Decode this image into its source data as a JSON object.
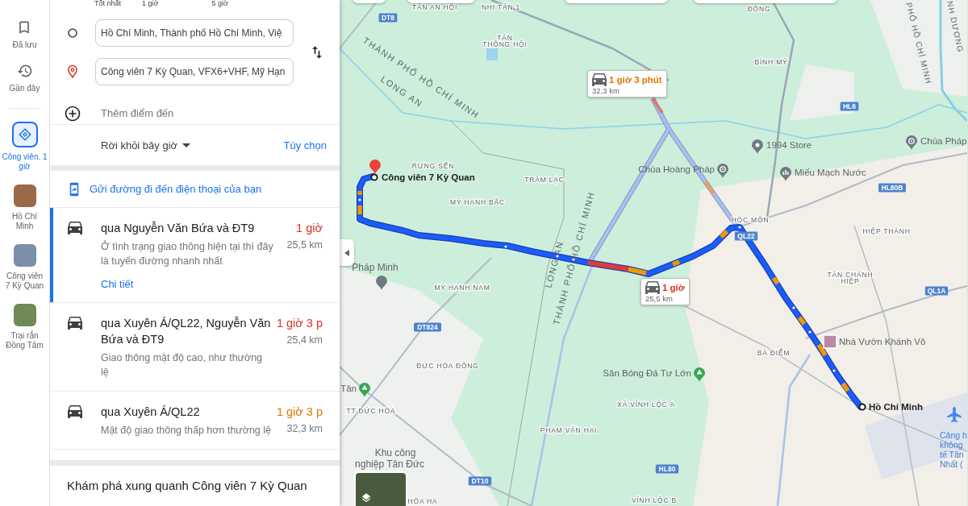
{
  "rail": {
    "items": [
      {
        "kind": "saved",
        "label": "Đã lưu",
        "selected": false
      },
      {
        "kind": "recent",
        "label": "Gần đây",
        "selected": false
      },
      {
        "kind": "directions",
        "label": "Công viên. 1 giờ",
        "selected": true
      },
      {
        "kind": "place",
        "label": "Hồ Chí Minh",
        "selected": false
      },
      {
        "kind": "place",
        "label": "Công viên 7 Kỳ Quan",
        "selected": false
      },
      {
        "kind": "place",
        "label": "Trại rắn Đồng Tâm",
        "selected": false
      }
    ]
  },
  "modes": [
    {
      "label": "Tốt nhất"
    },
    {
      "label": "1 giờ"
    },
    {
      "label": "5 giờ"
    }
  ],
  "directions": {
    "origin": "Hồ Chí Minh, Thành phố Hồ Chí Minh, Việ",
    "destination": "Công viên 7 Kỳ Quan, VFX6+VHF, Mỹ Hạn",
    "add_stop": "Thêm điểm đến",
    "depart": "Rời khỏi bây giờ",
    "options": "Tùy chọn",
    "send_to_phone": "Gửi đường đi đến điện thoại của bạn"
  },
  "routes": [
    {
      "title": "qua Nguyễn Văn Bứa và ĐT9",
      "time": "1 giờ",
      "color": "#d93025",
      "distance": "25,5 km",
      "description": "Ở tình trạng giao thông hiện tại thì đây là tuyến đường nhanh nhất",
      "details": "Chi tiết",
      "selected": true
    },
    {
      "title": "qua Xuyên Á/QL22, Nguyễn Văn Bứa và ĐT9",
      "time": "1 giờ 3 p",
      "color": "#d93025",
      "distance": "25,4 km",
      "description": "Giao thông mật độ cao, như thường lệ",
      "selected": false
    },
    {
      "title": "qua Xuyên Á/QL22",
      "time": "1 giờ 3 p",
      "color": "#e37400",
      "distance": "32,3 km",
      "description": "Mật độ giao thông thấp hơn thường lệ",
      "selected": false
    }
  ],
  "explore": "Khám phá xung quanh Công viên 7 Kỳ Quan",
  "map": {
    "labels": [
      {
        "text": "TÂN AN HỘI",
        "kind": "area"
      },
      {
        "text": "NHỊ TÂN 1",
        "kind": "area"
      },
      {
        "text": "DT8",
        "kind": "shield"
      },
      {
        "text": "ĐÔNG",
        "kind": "area"
      },
      {
        "text": "PHỐ HỒ CHÍ MINH",
        "kind": "region"
      },
      {
        "text": "NH DƯƠNG",
        "kind": "region"
      },
      {
        "text": "TÂN",
        "kind": "area"
      },
      {
        "text": "THÔNG HỘI",
        "kind": "area"
      },
      {
        "text": "THÀNH PHỐ HỒ CHÍ MINH",
        "kind": "region"
      },
      {
        "text": "BÌNH MỸ",
        "kind": "area"
      },
      {
        "text": "LONG AN",
        "kind": "region"
      },
      {
        "text": "HL6",
        "kind": "shield"
      },
      {
        "text": "1994 Store",
        "kind": "pin"
      },
      {
        "text": "Chùa Pháp",
        "kind": "temple"
      },
      {
        "text": "RỪNG SẾN",
        "kind": "area"
      },
      {
        "text": "Công viên 7 Kỳ Quan",
        "kind": "destination"
      },
      {
        "text": "Chùa Hoàng Pháp",
        "kind": "temple"
      },
      {
        "text": "Miếu Mạch Nước",
        "kind": "monument"
      },
      {
        "text": "TRÂM LẠC",
        "kind": "area"
      },
      {
        "text": "HL80B",
        "kind": "shield"
      },
      {
        "text": "MỸ HẠNH BẮC",
        "kind": "area"
      },
      {
        "text": "HÓC MÔN",
        "kind": "area"
      },
      {
        "text": "HIỆP THÀNH",
        "kind": "area"
      },
      {
        "text": "QL22",
        "kind": "shield"
      },
      {
        "text": "Pháp Minh",
        "kind": "place"
      },
      {
        "text": "LONG AN",
        "kind": "region"
      },
      {
        "text": "THÀNH PHỐ HỒ CHÍ MINH",
        "kind": "region"
      },
      {
        "text": "TÂN CHÁNH",
        "kind": "area"
      },
      {
        "text": "HIỆP",
        "kind": "area"
      },
      {
        "text": "MỸ HẠNH NAM",
        "kind": "area"
      },
      {
        "text": "QL1A",
        "kind": "shield"
      },
      {
        "text": "DT824",
        "kind": "shield"
      },
      {
        "text": "Nhà Vườn Khánh Vô",
        "kind": "photo"
      },
      {
        "text": "BÀ ĐIỂM",
        "kind": "area"
      },
      {
        "text": "ĐỨC HÒA ĐÔNG",
        "kind": "area"
      },
      {
        "text": "Sân Bóng Đá Tư Lớn",
        "kind": "park"
      },
      {
        "text": "Tân",
        "kind": "park"
      },
      {
        "text": "XÃ VĨNH LỘC A",
        "kind": "area"
      },
      {
        "text": "Hồ Chí Minh",
        "kind": "endpoint"
      },
      {
        "text": "TT ĐỨC HÒA",
        "kind": "area"
      },
      {
        "text": "Cảng h",
        "kind": "airport"
      },
      {
        "text": "không",
        "kind": "blue"
      },
      {
        "text": "tế Tân",
        "kind": "blue"
      },
      {
        "text": "Nhất (",
        "kind": "blue"
      },
      {
        "text": "PHẠM VĂN HAI",
        "kind": "area"
      },
      {
        "text": "Khu công",
        "kind": "place"
      },
      {
        "text": "nghiệp Tân Đức",
        "kind": "place"
      },
      {
        "text": "HL80",
        "kind": "shield"
      },
      {
        "text": "DT10",
        "kind": "shield"
      },
      {
        "text": "HÒA HA",
        "kind": "area"
      },
      {
        "text": "VĨNH LỘC B",
        "kind": "area"
      }
    ],
    "route_labels": [
      {
        "time": "1 giờ 3 phút",
        "distance": "32,3 km",
        "color": "#e37400"
      },
      {
        "time": "1 giờ",
        "distance": "25,5 km",
        "color": "#d93025"
      }
    ]
  }
}
